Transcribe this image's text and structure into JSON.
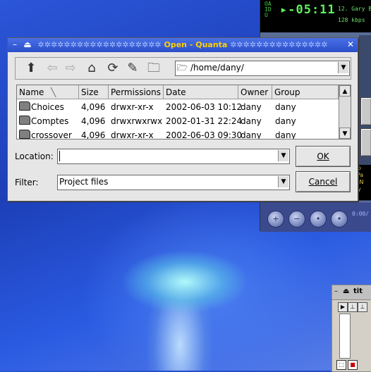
{
  "player": {
    "side_text": "OAIDU",
    "time": "▸-05:11",
    "track": "12. Gary B",
    "bitrate": "128 kbps",
    "playlist_lines": [
      ") Lo",
      "& Pa",
      "on N",
      "eny"
    ],
    "mini_time": "0:00/",
    "status_strip": "Gary Gorhe Fonthaeny"
  },
  "dialog": {
    "title_decoration_left": "✲✲✲✲✲✲✲✲✲✲✲✲✲✲✲✲✲✲✲",
    "title": "Open - Quanta",
    "title_decoration_right": "✲✲✲✲✲✲✲✲✲✲✲✲✲✲✲",
    "path": "/home/dany/",
    "columns": [
      "Name",
      "Size",
      "Permissions",
      "Date",
      "Owner",
      "Group"
    ],
    "files": [
      {
        "name": "Choices",
        "size": "4,096",
        "perm": "drwxr-xr-x",
        "date": "2002-06-03 10:12",
        "owner": "dany",
        "group": "dany"
      },
      {
        "name": "Comptes",
        "size": "4,096",
        "perm": "drwxrwxrwx",
        "date": "2002-01-31 22:24",
        "owner": "dany",
        "group": "dany"
      },
      {
        "name": "crossover",
        "size": "4,096",
        "perm": "drwxr-xr-x",
        "date": "2002-06-03 09:30",
        "owner": "dany",
        "group": "dany"
      }
    ],
    "location_label": "Location:",
    "location_value": "",
    "filter_label": "Filter:",
    "filter_value": "Project files",
    "ok_label": "OK",
    "cancel_label": "Cancel"
  },
  "small_window": {
    "title": "tit"
  },
  "colors": {
    "title_text": "#ffd000",
    "titlebar": "#3a5fd8",
    "lcd_green": "#5ef05e"
  }
}
